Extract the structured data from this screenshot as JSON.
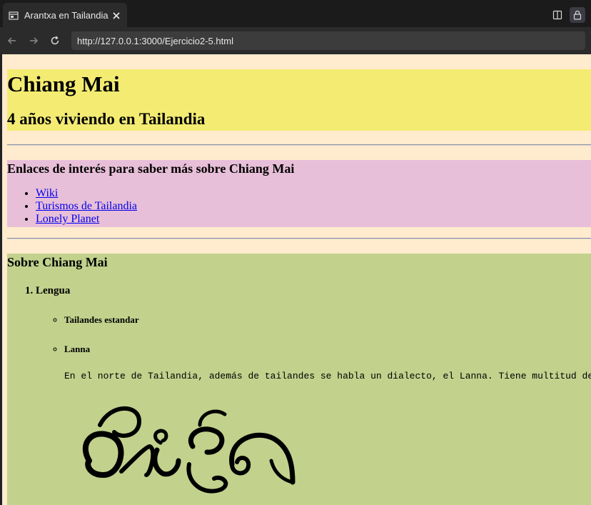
{
  "browser": {
    "tab_title": "Arantxa en Tailandia",
    "url": "http://127.0.0.1:3000/Ejercicio2-5.html"
  },
  "page": {
    "h1": "Chiang Mai",
    "h2": "4 años viviendo en Tailandia",
    "links_section": {
      "heading": "Enlaces de interés para saber más sobre Chiang Mai",
      "links": [
        "Wiki",
        "Turismos de Tailandia",
        "Lonely Planet"
      ]
    },
    "about_section": {
      "heading": "Sobre Chiang Mai",
      "items": [
        {
          "label": "Lengua",
          "sub_items": [
            "Tailandes estandar",
            "Lanna"
          ],
          "lanna_text": "En el norte de Tailandia, además de tailandes se habla un dialecto, el Lanna. Tiene multitud de"
        }
      ]
    }
  },
  "icons": {
    "favicon": "page-icon",
    "tab_close": "close-icon",
    "back": "back-arrow-icon",
    "forward": "forward-arrow-icon",
    "reload": "reload-icon",
    "split": "split-screen-icon",
    "lock": "lock-icon"
  },
  "colors": {
    "page_background": "#ffebcd",
    "header_section": "#f4ec72",
    "links_section": "#e8bfd8",
    "about_section": "#c2d18c",
    "link": "#0000ee"
  }
}
